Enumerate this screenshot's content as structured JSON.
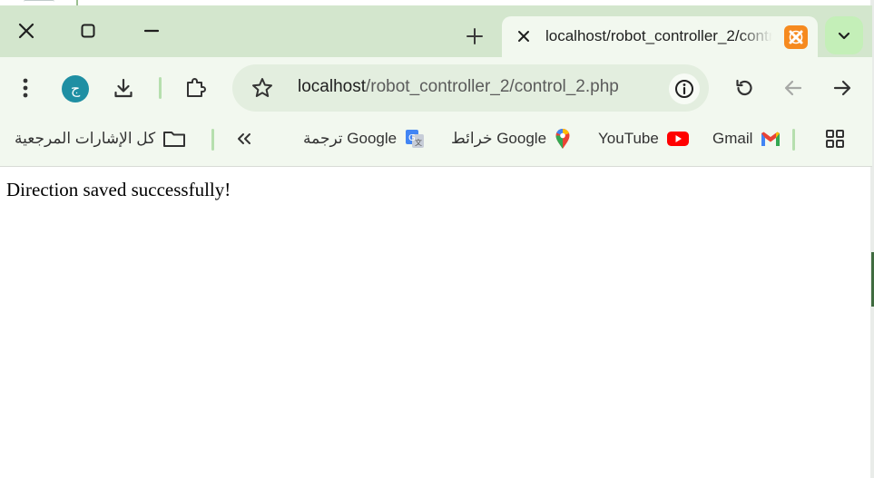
{
  "window": {
    "controls": {
      "close_icon": "close-icon",
      "maximize_icon": "square-icon",
      "minimize_icon": "minus-icon"
    }
  },
  "tabs": {
    "new_tab_icon": "plus-icon",
    "active": {
      "title": "localhost/robot_controller_2/control_2.php",
      "favicon": "xampp-icon",
      "favicon_color": "#F68A1F"
    },
    "search_tabs_icon": "chevron-down-icon"
  },
  "toolbar": {
    "menu_icon": "more-vertical-icon",
    "profile_initial": "ج",
    "download_icon": "download-icon",
    "extensions_icon": "puzzle-icon",
    "omnibox": {
      "bookmark_icon": "star-icon",
      "url_host": "localhost",
      "url_path": "/robot_controller_2/control_2.php",
      "site_info_icon": "info-icon"
    },
    "reload_icon": "reload-icon",
    "back_icon": "arrow-left-icon",
    "forward_icon": "arrow-right-icon"
  },
  "bookmarks": {
    "all_bookmarks": "كل الإشارات المرجعية",
    "overflow_icon": "double-chevron-icon",
    "items": [
      {
        "label": "ترجمة Google",
        "icon": "google-translate-icon"
      },
      {
        "label": "خرائط Google",
        "icon": "google-maps-icon"
      },
      {
        "label": "YouTube",
        "icon": "youtube-icon"
      },
      {
        "label": "Gmail",
        "icon": "gmail-icon"
      }
    ],
    "apps_icon": "apps-grid-icon"
  },
  "page": {
    "message": "Direction saved successfully!"
  },
  "colors": {
    "tabstrip": "#D3E6CD",
    "toolbar": "#F2F8EF",
    "omnibox": "#E3EEDF",
    "accent": "#C4EFB8",
    "avatar": "#1F8FA3",
    "youtube_red": "#FF0000"
  }
}
